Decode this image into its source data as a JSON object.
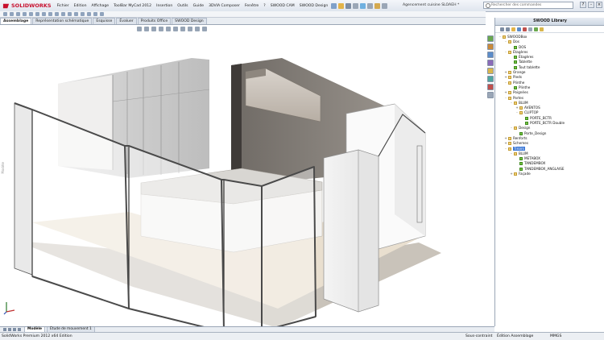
{
  "app": {
    "logo_text": "SOLIDWORKS",
    "document_title": "Agencement cuisine SLOAEH *",
    "search_placeholder": "Rechercher des commandes"
  },
  "menu": [
    "Fichier",
    "Edition",
    "Affichage",
    "ToolBar MyCad 2012",
    "Insertion",
    "Outils",
    "Guide",
    "3DVIA Composer",
    "Fenêtre",
    "?",
    "SWOOD CAM",
    "SWOOD Design"
  ],
  "command_tabs": [
    {
      "label": "Assemblage",
      "active": true
    },
    {
      "label": "Représentation schématique",
      "active": false
    },
    {
      "label": "Esquisse",
      "active": false
    },
    {
      "label": "Évaluer",
      "active": false
    },
    {
      "label": "Produits Office",
      "active": false
    },
    {
      "label": "SWOOD Design",
      "active": false
    }
  ],
  "viewport": {
    "side_label": "Modèle"
  },
  "library": {
    "title": "SWOOD Library",
    "tree": [
      {
        "label": "SWOODBox",
        "level": 0,
        "type": "folder",
        "expander": "-"
      },
      {
        "label": "Dos",
        "level": 1,
        "type": "folder",
        "expander": "-"
      },
      {
        "label": "DOS",
        "level": 2,
        "type": "leaf",
        "expander": ""
      },
      {
        "label": "Étagères",
        "level": 1,
        "type": "folder",
        "expander": "-"
      },
      {
        "label": "Étagères",
        "level": 2,
        "type": "leaf",
        "expander": ""
      },
      {
        "label": "Tablette",
        "level": 2,
        "type": "leaf",
        "expander": ""
      },
      {
        "label": "Tout tablette",
        "level": 2,
        "type": "leaf",
        "expander": ""
      },
      {
        "label": "Orange",
        "level": 1,
        "type": "folder",
        "expander": "+"
      },
      {
        "label": "Pieds",
        "level": 1,
        "type": "folder",
        "expander": "+"
      },
      {
        "label": "Plinthe",
        "level": 1,
        "type": "folder",
        "expander": "-"
      },
      {
        "label": "Plinthe",
        "level": 2,
        "type": "leaf",
        "expander": ""
      },
      {
        "label": "Poignées",
        "level": 1,
        "type": "folder",
        "expander": "+"
      },
      {
        "label": "Portes",
        "level": 1,
        "type": "folder",
        "expander": "-"
      },
      {
        "label": "BLUM",
        "level": 2,
        "type": "folder",
        "expander": "-"
      },
      {
        "label": "AVENTOS",
        "level": 3,
        "type": "folder",
        "expander": "+"
      },
      {
        "label": "CLIPTOP",
        "level": 3,
        "type": "folder",
        "expander": "-"
      },
      {
        "label": "PORTE_BCTR",
        "level": 4,
        "type": "leaf",
        "expander": ""
      },
      {
        "label": "PORTE_BCTR Double",
        "level": 4,
        "type": "leaf",
        "expander": ""
      },
      {
        "label": "Design",
        "level": 2,
        "type": "folder",
        "expander": "-"
      },
      {
        "label": "Porte_Design",
        "level": 3,
        "type": "leaf",
        "expander": ""
      },
      {
        "label": "Renforts",
        "level": 1,
        "type": "folder",
        "expander": "+"
      },
      {
        "label": "Schemes",
        "level": 1,
        "type": "folder",
        "expander": "+"
      },
      {
        "label": "Tiroirs",
        "level": 1,
        "type": "folder",
        "expander": "-",
        "selected": true
      },
      {
        "label": "BLUM",
        "level": 2,
        "type": "folder",
        "expander": "-"
      },
      {
        "label": "METABOX",
        "level": 3,
        "type": "leaf",
        "expander": ""
      },
      {
        "label": "TANDEMBOX",
        "level": 3,
        "type": "leaf",
        "expander": ""
      },
      {
        "label": "TANDEMBOX_ANGLAISE",
        "level": 3,
        "type": "leaf",
        "expander": ""
      },
      {
        "label": "Façade",
        "level": 2,
        "type": "folder",
        "expander": "+"
      }
    ]
  },
  "bottom_tabs": [
    {
      "label": "Modèle",
      "active": true
    },
    {
      "label": "Étude de mouvement 1",
      "active": false
    }
  ],
  "status": {
    "product": "SolidWorks Premium 2012 x64 Edition",
    "constraint": "Sous-contraint",
    "mode": "Édition Assemblage",
    "units": "MMGS"
  },
  "colors": {
    "logo_red": "#c8102e",
    "selection_blue": "#3b78d6",
    "folder_yellow": "#f0d27a",
    "leaf_green": "#78c443"
  }
}
